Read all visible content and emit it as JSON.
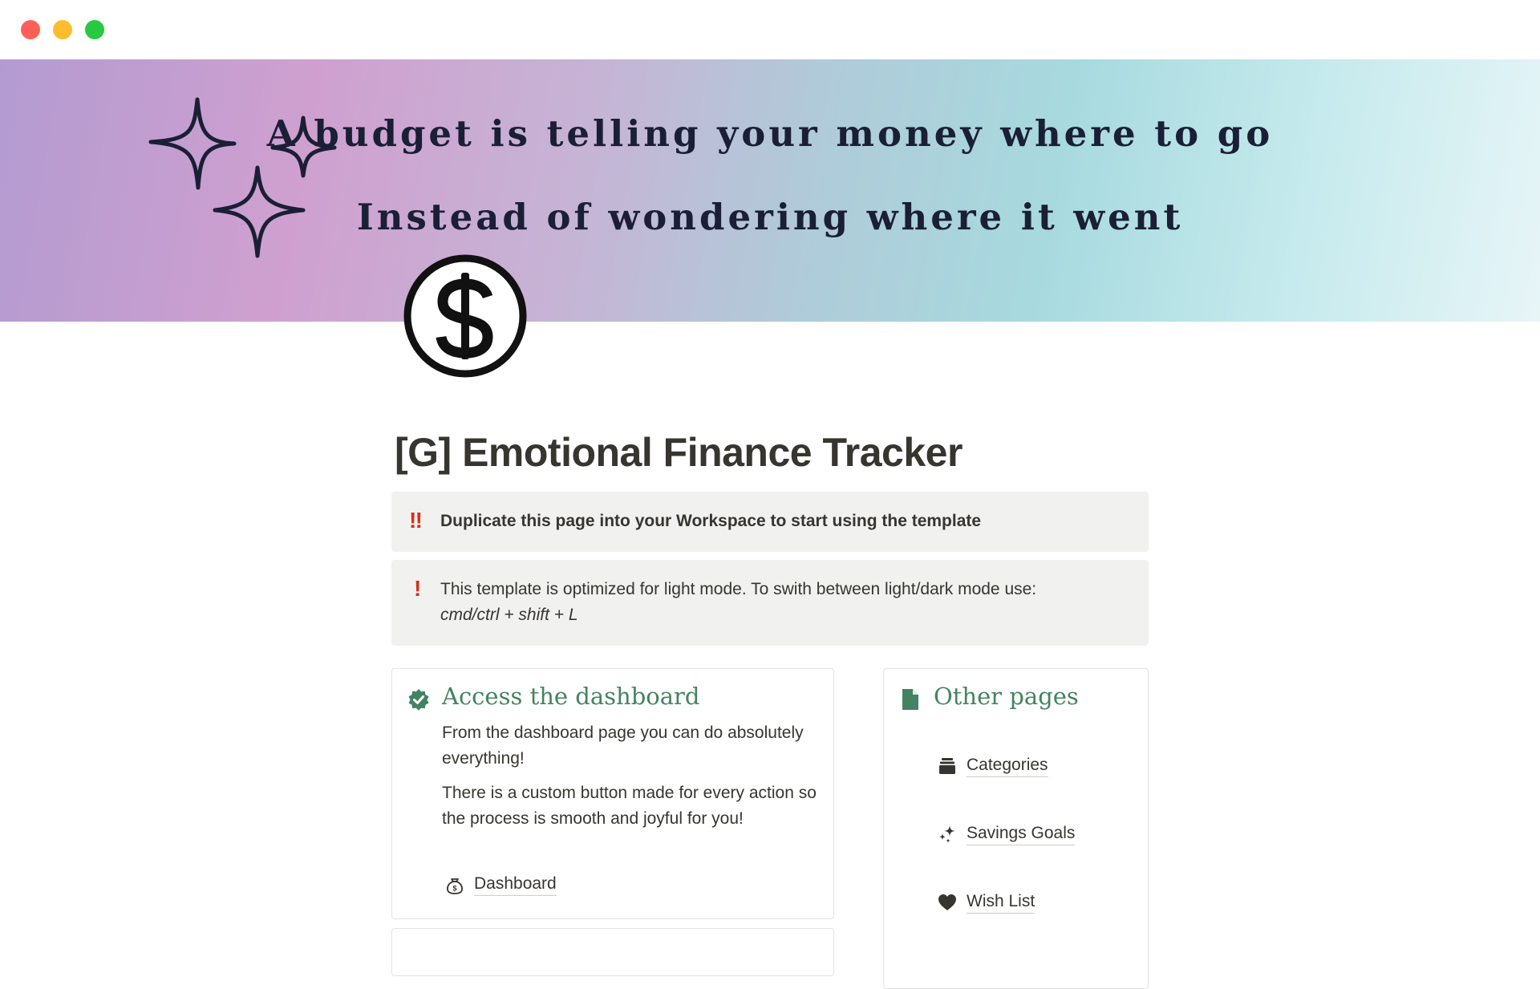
{
  "cover": {
    "line1": "A budget is telling your money where to go",
    "line2": "Instead of wondering where it went"
  },
  "page": {
    "icon": "dollar-coin-icon",
    "title": "[G] Emotional Finance Tracker"
  },
  "callouts": [
    {
      "icon": "double-exclamation-icon",
      "icon_glyph": "‼",
      "text": "Duplicate this page into your Workspace to start using the template"
    },
    {
      "icon": "exclamation-icon",
      "icon_glyph": "!",
      "text": "This template is optimized for light mode. To swith between light/dark mode use:",
      "shortcut": "cmd/ctrl + shift + L"
    }
  ],
  "dashboard_card": {
    "icon": "verified-check-icon",
    "heading": "Access the dashboard",
    "para1": "From the dashboard page you can do absolutely everything!",
    "para2": "There is a custom button made for every action so the process is smooth and joyful for you!",
    "link": {
      "icon": "money-bag-icon",
      "label": "Dashboard"
    }
  },
  "other_card": {
    "icon": "document-icon",
    "heading": "Other pages",
    "links": [
      {
        "icon": "archive-stack-icon",
        "label": "Categories"
      },
      {
        "icon": "sparkles-icon",
        "label": "Savings Goals"
      },
      {
        "icon": "heart-icon",
        "label": "Wish List"
      }
    ]
  },
  "colors": {
    "heading_green": "#448361",
    "callout_red": "#d4301f",
    "callout_bg": "#f1f1ef",
    "text": "#37352f"
  }
}
